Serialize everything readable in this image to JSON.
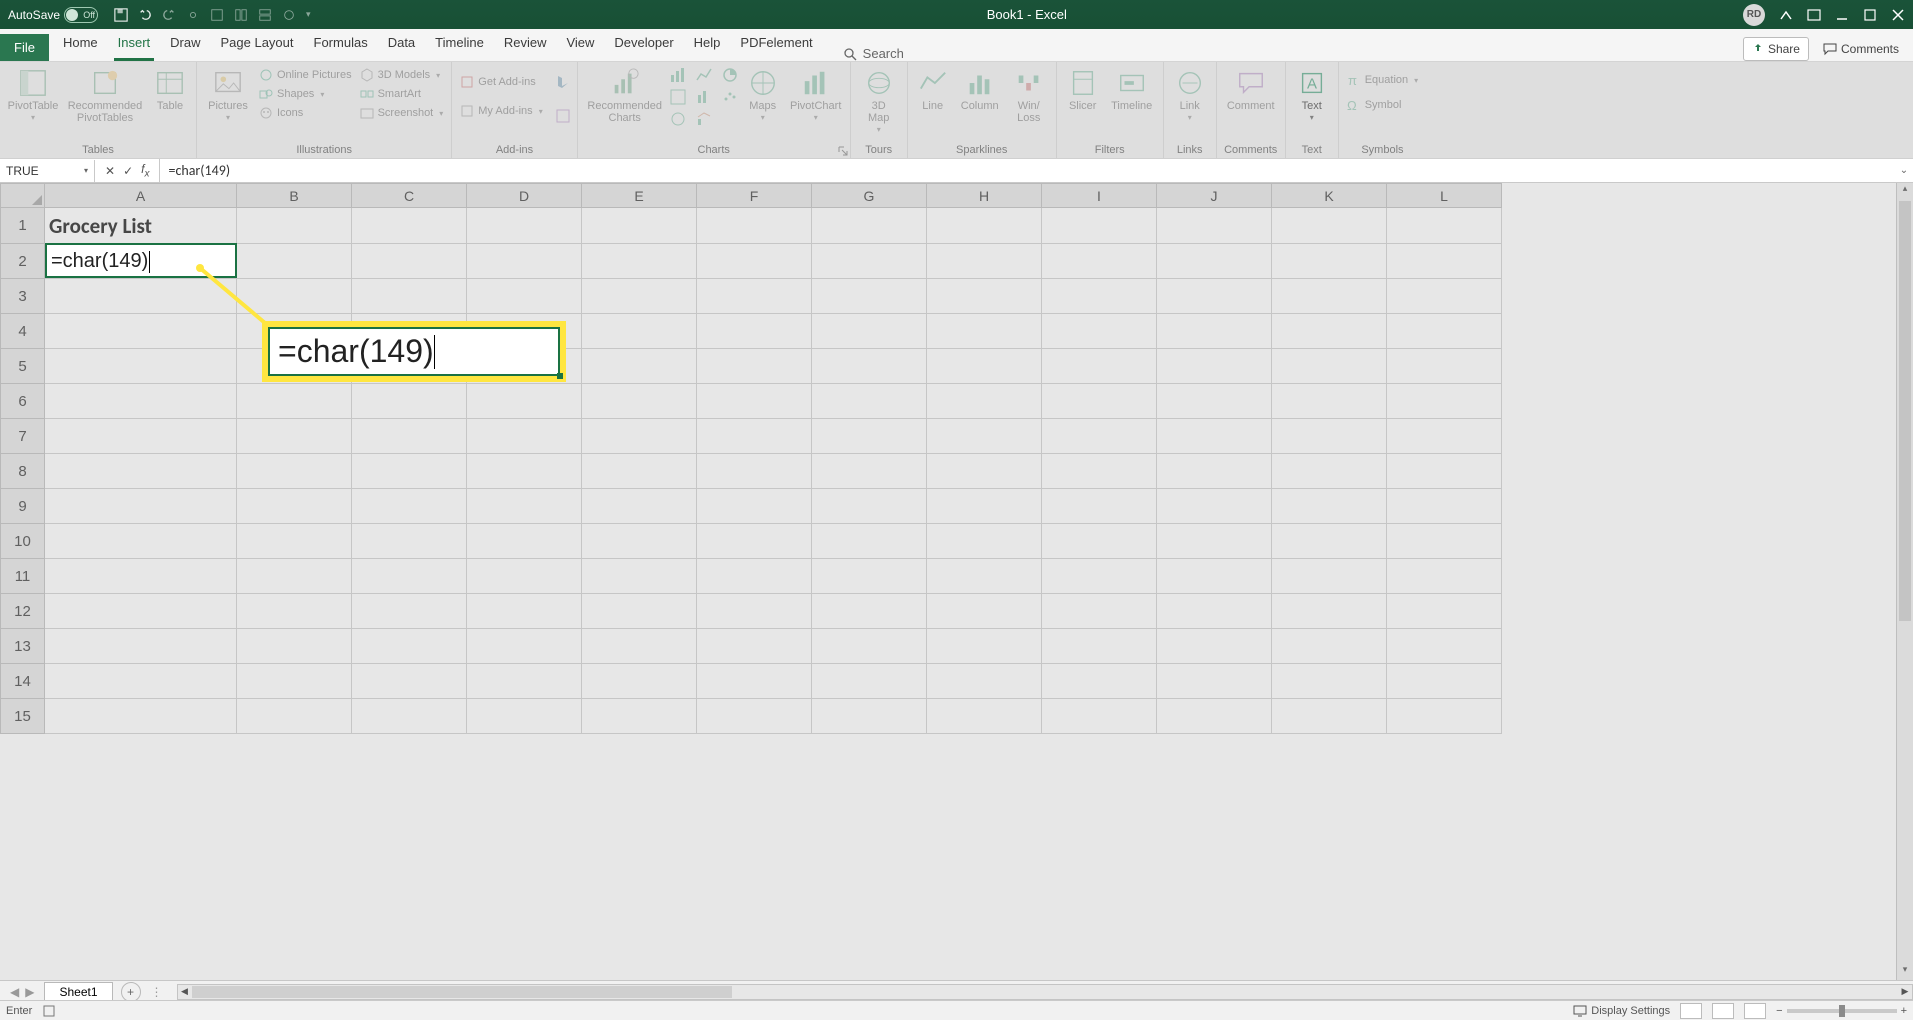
{
  "titlebar": {
    "autosave_label": "AutoSave",
    "autosave_state": "Off",
    "title": "Book1  -  Excel",
    "avatar_initials": "RD"
  },
  "tabs": {
    "file": "File",
    "list": [
      "Home",
      "Insert",
      "Draw",
      "Page Layout",
      "Formulas",
      "Data",
      "Timeline",
      "Review",
      "View",
      "Developer",
      "Help",
      "PDFelement"
    ],
    "active_index": 1,
    "search_placeholder": "Search",
    "share": "Share",
    "comments": "Comments"
  },
  "ribbon": {
    "groups": {
      "tables": {
        "label": "Tables",
        "pivottable": "PivotTable",
        "recommended": "Recommended\nPivotTables",
        "table": "Table"
      },
      "illustrations": {
        "label": "Illustrations",
        "pictures": "Pictures",
        "online_pictures": "Online Pictures",
        "shapes": "Shapes",
        "icons": "Icons",
        "models": "3D Models",
        "smartart": "SmartArt",
        "screenshot": "Screenshot"
      },
      "addins": {
        "label": "Add-ins",
        "get": "Get Add-ins",
        "my": "My Add-ins"
      },
      "charts": {
        "label": "Charts",
        "recommended": "Recommended\nCharts",
        "maps": "Maps",
        "pivotchart": "PivotChart"
      },
      "tours": {
        "label": "Tours",
        "map": "3D\nMap"
      },
      "sparklines": {
        "label": "Sparklines",
        "line": "Line",
        "column": "Column",
        "winloss": "Win/\nLoss"
      },
      "filters": {
        "label": "Filters",
        "slicer": "Slicer",
        "timeline": "Timeline"
      },
      "links": {
        "label": "Links",
        "link": "Link"
      },
      "comments": {
        "label": "Comments",
        "comment": "Comment"
      },
      "text": {
        "label": "Text",
        "text": "Text"
      },
      "symbols": {
        "label": "Symbols",
        "equation": "Equation",
        "symbol": "Symbol"
      }
    }
  },
  "fbar": {
    "namebox": "TRUE",
    "formula": "=char(149)"
  },
  "grid": {
    "columns": [
      "A",
      "B",
      "C",
      "D",
      "E",
      "F",
      "G",
      "H",
      "I",
      "J",
      "K",
      "L"
    ],
    "rows": 15,
    "a1": "Grocery List",
    "a2": "=char(149)"
  },
  "callout": {
    "text": "=char(149)"
  },
  "sheetbar": {
    "tab": "Sheet1"
  },
  "status": {
    "mode": "Enter",
    "display_settings": "Display Settings",
    "zoom_minus": "−",
    "zoom_plus": "+"
  }
}
